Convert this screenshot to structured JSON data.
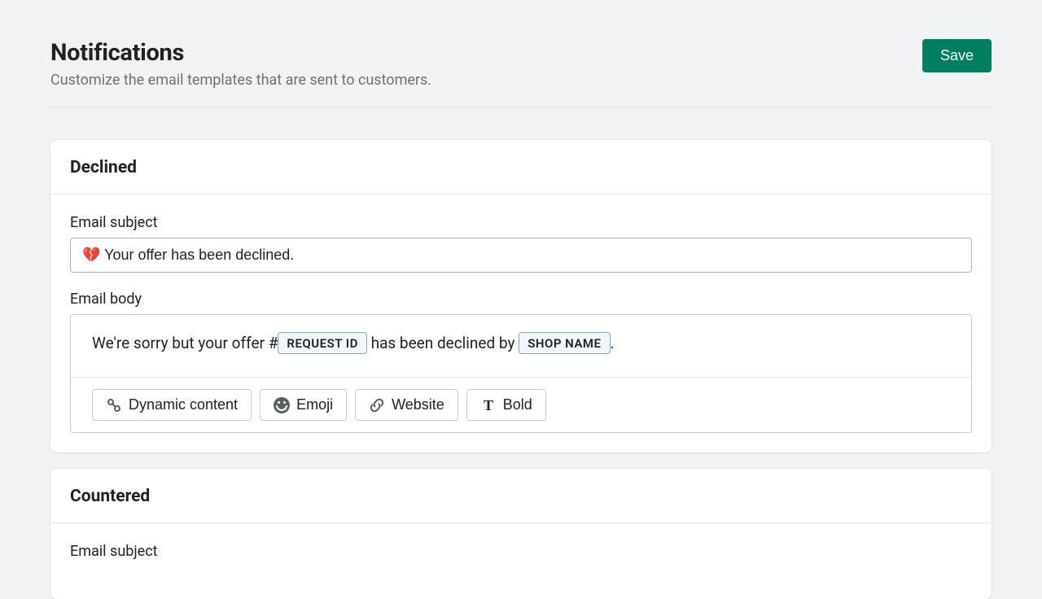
{
  "header": {
    "title": "Notifications",
    "subtitle": "Customize the email templates that are sent to customers.",
    "save_label": "Save"
  },
  "cards": {
    "declined": {
      "title": "Declined",
      "subject_label": "Email subject",
      "subject_value": "💔 Your offer has been declined.",
      "body_label": "Email body",
      "body_parts": {
        "p1": "We're sorry but your offer #",
        "token1": "REQUEST ID",
        "p2": " has been declined by ",
        "token2": "SHOP NAME",
        "p3": "."
      },
      "toolbar": {
        "dynamic": "Dynamic content",
        "emoji": "Emoji",
        "website": "Website",
        "bold": "Bold"
      }
    },
    "countered": {
      "title": "Countered",
      "subject_label": "Email subject"
    }
  }
}
